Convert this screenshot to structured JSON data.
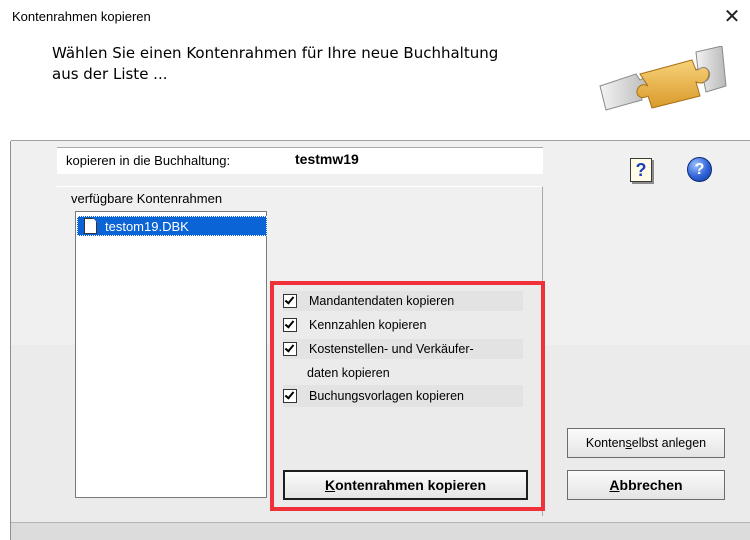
{
  "window": {
    "title": "Kontenrahmen kopieren",
    "close_glyph": "✕"
  },
  "header": {
    "message_line1": "Wählen Sie einen Kontenrahmen für Ihre neue Buchhaltung",
    "message_line2": "aus der Liste ...",
    "image_icon": "puzzle-piece-icon"
  },
  "target": {
    "label": "kopieren in die Buchhaltung:",
    "value": "testmw19"
  },
  "help": {
    "icon1_glyph": "?",
    "icon2_glyph": "?"
  },
  "list": {
    "group_label": "verfügbare Kontenrahmen",
    "items": [
      {
        "label": "testom19.DBK",
        "selected": true
      }
    ]
  },
  "options": {
    "items": [
      {
        "label": "Mandantendaten kopieren",
        "checked": true
      },
      {
        "label": "Kennzahlen kopieren",
        "checked": true
      },
      {
        "label": "Kostenstellen- und Verkäufer-",
        "label_cont": "daten kopieren",
        "checked": true
      },
      {
        "label": "Buchungsvorlagen kopieren",
        "checked": true
      }
    ],
    "highlight_color": "#f0313a"
  },
  "buttons": {
    "copy_pre": "",
    "copy_mnemonic": "K",
    "copy_post": "ontenrahmen kopieren",
    "create_pre": "Konten ",
    "create_mnemonic": "s",
    "create_post": "elbst anlegen",
    "cancel_pre": "",
    "cancel_mnemonic": "A",
    "cancel_post": "bbrechen"
  },
  "colors": {
    "selection": "#0a64d6",
    "dialog_bg": "#f0f0f0"
  }
}
